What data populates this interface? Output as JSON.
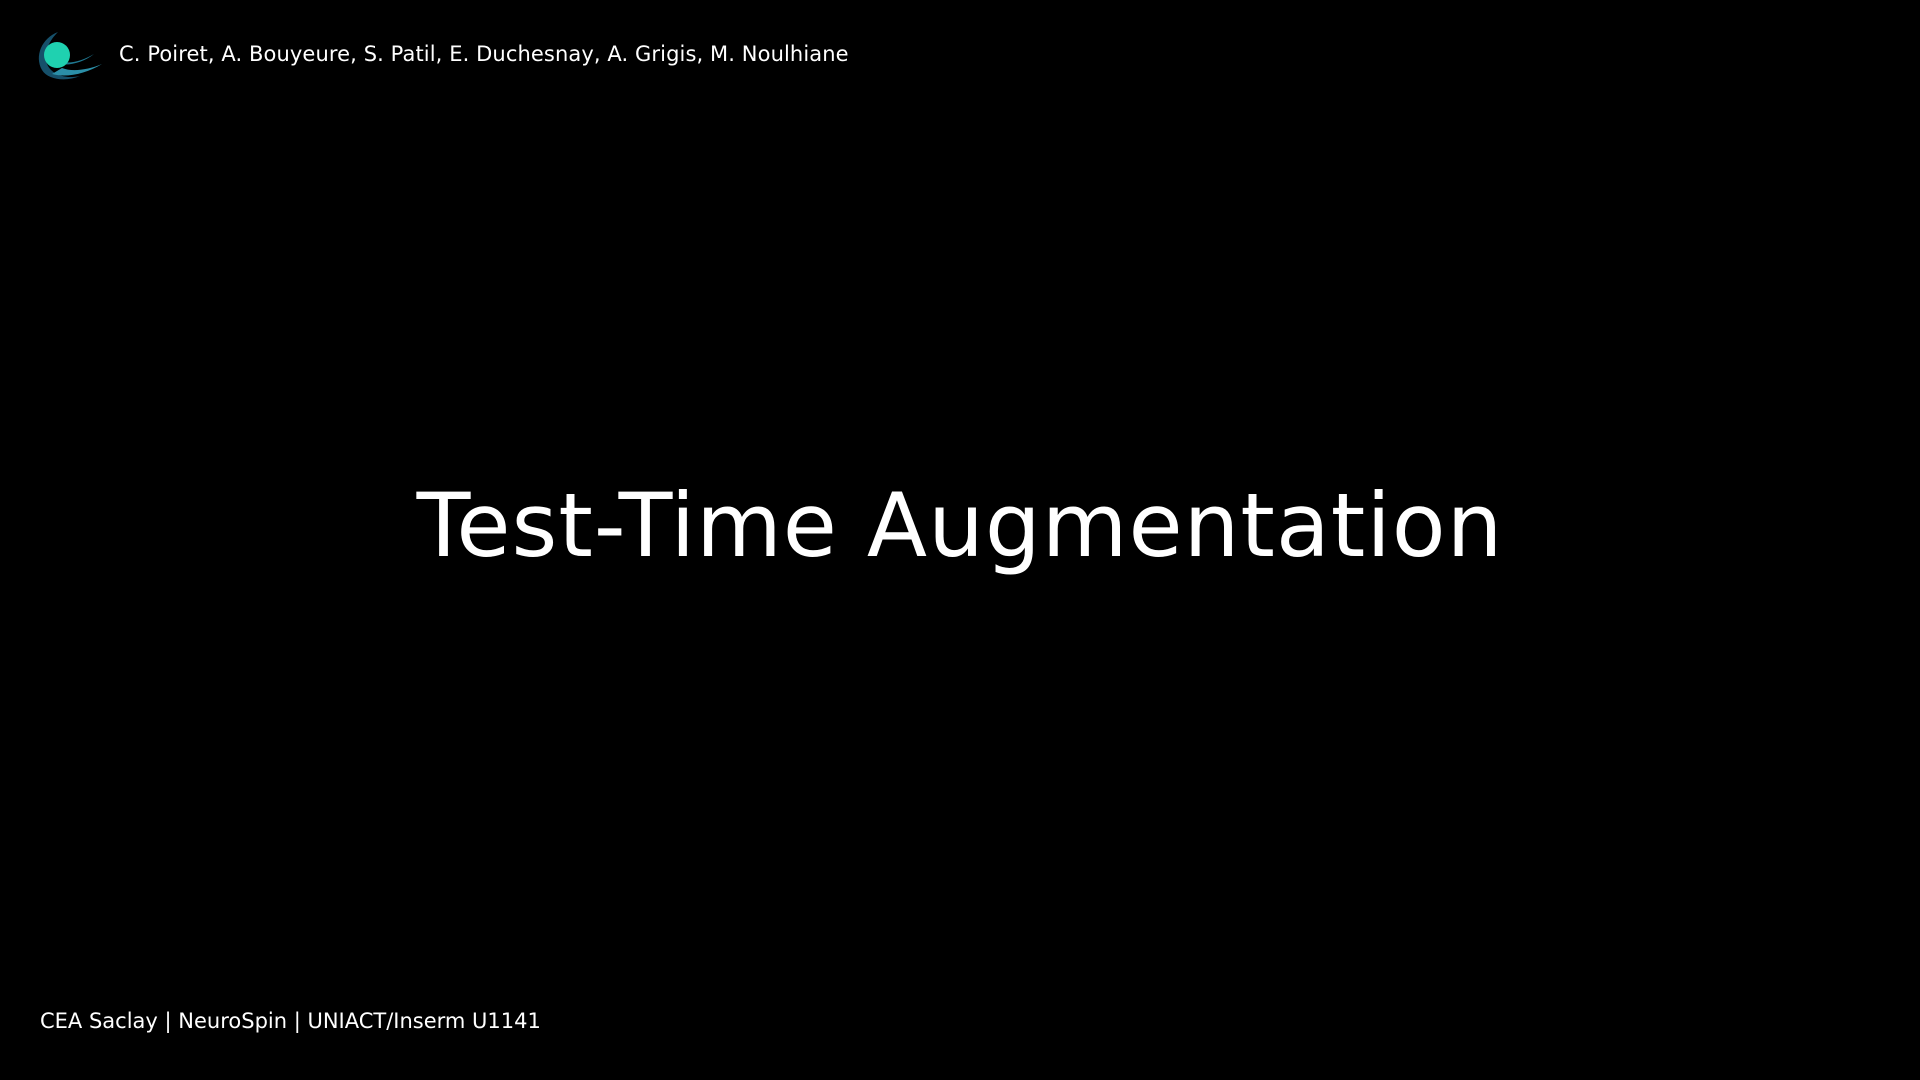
{
  "header": {
    "logo_icon": "cyan-sphere-wave-logo-icon",
    "authors": "C. Poiret, A. Bouyeure, S. Patil, E. Duchesnay, A. Grigis, M. Noulhiane"
  },
  "slide": {
    "title": "Test-Time Augmentation"
  },
  "footer": {
    "affiliations": "CEA Saclay | NeuroSpin | UNIACT/Inserm U1141"
  },
  "colors": {
    "background": "#000000",
    "text": "#ffffff",
    "logo_sphere": "#1fd1b0",
    "logo_wave_dark": "#16506a",
    "logo_wave_light": "#2b8fa8"
  }
}
